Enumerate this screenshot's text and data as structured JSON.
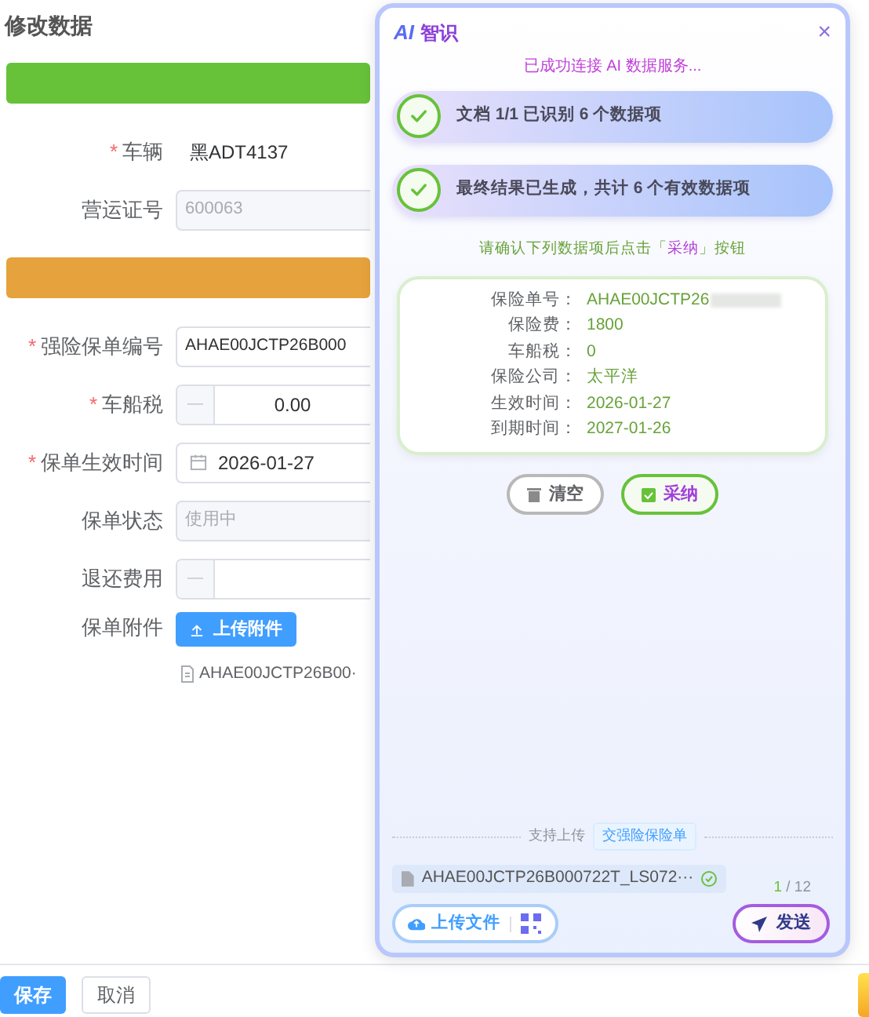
{
  "page": {
    "title": "修改数据"
  },
  "form": {
    "rows": [
      {
        "kind": "bar",
        "color": "#67c23a"
      },
      {
        "kind": "static",
        "label": "车辆",
        "mark": "*",
        "value": "黑ADT4137"
      },
      {
        "kind": "input",
        "label": "营运证号",
        "value": "600063",
        "disabled": true
      },
      {
        "kind": "bar",
        "color": "#e6a23c"
      },
      {
        "kind": "input",
        "label": "强险保单编号",
        "mark": "*",
        "value": "AHAE00JCTP26B000",
        "disabled": false
      },
      {
        "kind": "number",
        "label": "车船税",
        "mark": "*",
        "value": "0.00",
        "minus": "—"
      },
      {
        "kind": "date",
        "label": "保单生效时间",
        "mark": "*",
        "value": "2026-01-27"
      },
      {
        "kind": "input",
        "label": "保单状态",
        "value": "使用中",
        "disabled": true
      },
      {
        "kind": "number",
        "label": "退还费用",
        "minus": "—"
      },
      {
        "kind": "upload",
        "label": "保单附件",
        "button": "上传附件",
        "file": "AHAE00JCTP26B00·"
      }
    ]
  },
  "footer": {
    "buttons": [
      {
        "label": "保存",
        "primary": true
      },
      {
        "label": "取消",
        "primary": false
      }
    ]
  },
  "assistant": {
    "logo": "AI",
    "title": "智识",
    "close": "×",
    "status": "已成功连接 AI 数据服务...",
    "steps": [
      {
        "text": "文档 1/1 已识别 6 个数据项",
        "done": true
      },
      {
        "text": "最终结果已生成，共计 6 个有效数据项",
        "done": true
      }
    ],
    "hint": {
      "before": "请确认下列数据项后点击「",
      "highlight": "采纳",
      "after": "」按钮"
    },
    "result": [
      {
        "label": "保险单号：",
        "value": "AHAE00JCTP26",
        "redacted": true
      },
      {
        "label": "保险费：",
        "value": "1800",
        "redacted": false
      },
      {
        "label": "车船税：",
        "value": "0",
        "redacted": false
      },
      {
        "label": "保险公司：",
        "value": "太平洋",
        "redacted": false
      },
      {
        "label": "生效时间：",
        "value": "2026-01-27",
        "redacted": false
      },
      {
        "label": "到期时间：",
        "value": "2027-01-26",
        "redacted": false
      }
    ],
    "clear_button": "清空",
    "accept_button": "采纳",
    "support_label": "支持上传",
    "support_tag": "交强险保险单",
    "attachment": {
      "name": "AHAE00JCTP26B000722T_LS072···",
      "uploaded": true
    },
    "counter": {
      "current": "1",
      "total": "/ 12"
    },
    "upload_button": "上传文件",
    "send_button": "发送"
  }
}
